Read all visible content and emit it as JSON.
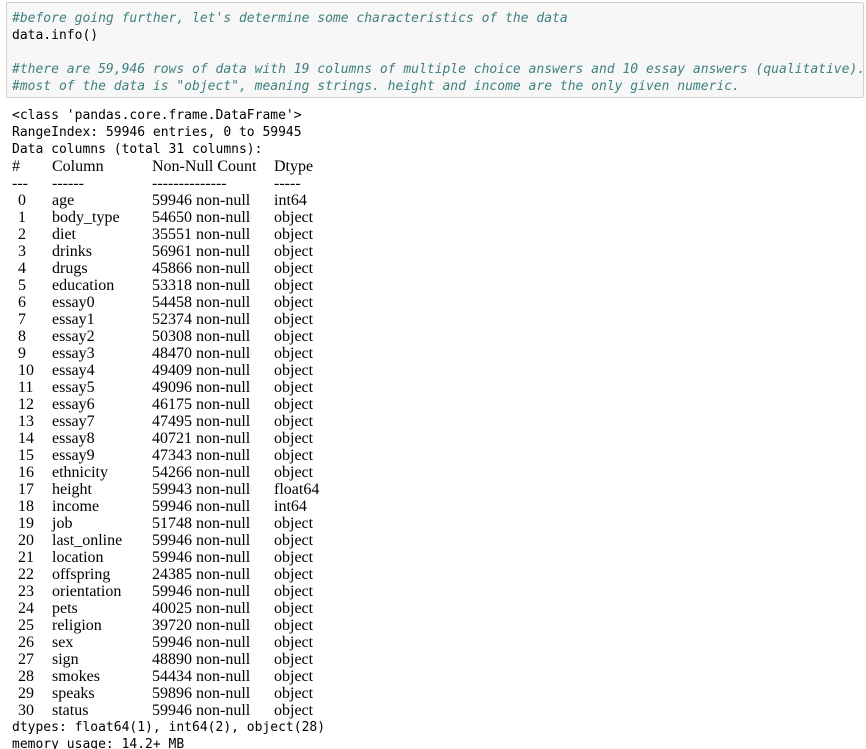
{
  "input_cell": {
    "line1": "#before going further, let's determine some characteristics of the data",
    "line2": "data.info()",
    "line3": "#there are 59,946 rows of data with 19 columns of multiple choice answers and 10 essay answers (qualitative).",
    "line4": "#most of the data is \"object\", meaning strings. height and income are the only given numeric."
  },
  "output": {
    "class_line": "<class 'pandas.core.frame.DataFrame'>",
    "range_line": "RangeIndex: 59946 entries, 0 to 59945",
    "columns_line": "Data columns (total 31 columns):",
    "header": {
      "idx": " #",
      "name": "Column",
      "count": "Non-Null Count",
      "dtype": "Dtype"
    },
    "divider": {
      "idx": "---",
      "name": "------",
      "count": "--------------",
      "dtype": "-----"
    },
    "rows": [
      {
        "idx": "0",
        "name": "age",
        "count": "59946 non-null",
        "dtype": "int64"
      },
      {
        "idx": "1",
        "name": "body_type",
        "count": "54650 non-null",
        "dtype": "object"
      },
      {
        "idx": "2",
        "name": "diet",
        "count": "35551 non-null",
        "dtype": "object"
      },
      {
        "idx": "3",
        "name": "drinks",
        "count": "56961 non-null",
        "dtype": "object"
      },
      {
        "idx": "4",
        "name": "drugs",
        "count": "45866 non-null",
        "dtype": "object"
      },
      {
        "idx": "5",
        "name": "education",
        "count": "53318 non-null",
        "dtype": "object"
      },
      {
        "idx": "6",
        "name": "essay0",
        "count": "54458 non-null",
        "dtype": "object"
      },
      {
        "idx": "7",
        "name": "essay1",
        "count": "52374 non-null",
        "dtype": "object"
      },
      {
        "idx": "8",
        "name": "essay2",
        "count": "50308 non-null",
        "dtype": "object"
      },
      {
        "idx": "9",
        "name": "essay3",
        "count": "48470 non-null",
        "dtype": "object"
      },
      {
        "idx": "10",
        "name": "essay4",
        "count": "49409 non-null",
        "dtype": "object"
      },
      {
        "idx": "11",
        "name": "essay5",
        "count": "49096 non-null",
        "dtype": "object"
      },
      {
        "idx": "12",
        "name": "essay6",
        "count": "46175 non-null",
        "dtype": "object"
      },
      {
        "idx": "13",
        "name": "essay7",
        "count": "47495 non-null",
        "dtype": "object"
      },
      {
        "idx": "14",
        "name": "essay8",
        "count": "40721 non-null",
        "dtype": "object"
      },
      {
        "idx": "15",
        "name": "essay9",
        "count": "47343 non-null",
        "dtype": "object"
      },
      {
        "idx": "16",
        "name": "ethnicity",
        "count": "54266 non-null",
        "dtype": "object"
      },
      {
        "idx": "17",
        "name": "height",
        "count": "59943 non-null",
        "dtype": "float64"
      },
      {
        "idx": "18",
        "name": "income",
        "count": "59946 non-null",
        "dtype": "int64"
      },
      {
        "idx": "19",
        "name": "job",
        "count": "51748 non-null",
        "dtype": "object"
      },
      {
        "idx": "20",
        "name": "last_online",
        "count": "59946 non-null",
        "dtype": "object"
      },
      {
        "idx": "21",
        "name": "location",
        "count": "59946 non-null",
        "dtype": "object"
      },
      {
        "idx": "22",
        "name": "offspring",
        "count": "24385 non-null",
        "dtype": "object"
      },
      {
        "idx": "23",
        "name": "orientation",
        "count": "59946 non-null",
        "dtype": "object"
      },
      {
        "idx": "24",
        "name": "pets",
        "count": "40025 non-null",
        "dtype": "object"
      },
      {
        "idx": "25",
        "name": "religion",
        "count": "39720 non-null",
        "dtype": "object"
      },
      {
        "idx": "26",
        "name": "sex",
        "count": "59946 non-null",
        "dtype": "object"
      },
      {
        "idx": "27",
        "name": "sign",
        "count": "48890 non-null",
        "dtype": "object"
      },
      {
        "idx": "28",
        "name": "smokes",
        "count": "54434 non-null",
        "dtype": "object"
      },
      {
        "idx": "29",
        "name": "speaks",
        "count": "59896 non-null",
        "dtype": "object"
      },
      {
        "idx": "30",
        "name": "status",
        "count": "59946 non-null",
        "dtype": "object"
      }
    ],
    "dtypes_line": "dtypes: float64(1), int64(2), object(28)",
    "memory_line": "memory usage: 14.2+ MB"
  }
}
